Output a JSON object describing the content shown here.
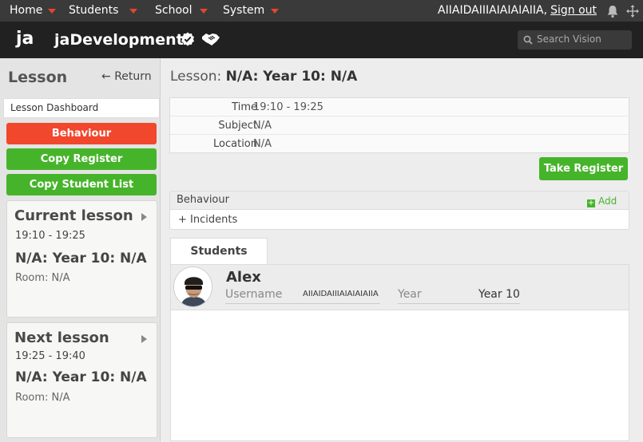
{
  "nav": {
    "items": [
      "Home",
      "Students",
      "School",
      "System"
    ],
    "user": "AIIAIDAIIIAIAIAIAIIA,",
    "signout": "Sign out"
  },
  "brand": {
    "logo": "ja",
    "title": "jaDevelopment",
    "search_placeholder": "Search Vision"
  },
  "sidebar": {
    "title": "Lesson",
    "return_label": "Return",
    "dashboard_link": "Lesson Dashboard",
    "buttons": {
      "behaviour": "Behaviour",
      "copy_register": "Copy Register",
      "copy_student_list": "Copy Student List"
    },
    "current": {
      "title": "Current lesson",
      "time": "19:10 - 19:25",
      "name": "N/A: Year 10: N/A",
      "room": "Room: N/A"
    },
    "next": {
      "title": "Next lesson",
      "time": "19:25 - 19:40",
      "name": "N/A: Year 10: N/A",
      "room": "Room: N/A"
    }
  },
  "main": {
    "heading_prefix": "Lesson:",
    "heading_value": "N/A: Year 10: N/A",
    "info": [
      {
        "key": "Time",
        "value": "19:10 - 19:25"
      },
      {
        "key": "Subject",
        "value": "N/A"
      },
      {
        "key": "Location",
        "value": "N/A"
      }
    ],
    "take_register": "Take Register",
    "behaviour": {
      "title": "Behaviour",
      "add": "Add",
      "incidents": "+ Incidents"
    },
    "students_tab": "Students",
    "student": {
      "name": "Alex",
      "username_label": "Username",
      "username": "AIIAIDAIIIAIAIAIAIIA",
      "year_label": "Year",
      "year": "Year 10"
    }
  },
  "colors": {
    "accent_red": "#f1472d",
    "accent_green": "#46b42a",
    "nav_caret": "#e8452a"
  }
}
